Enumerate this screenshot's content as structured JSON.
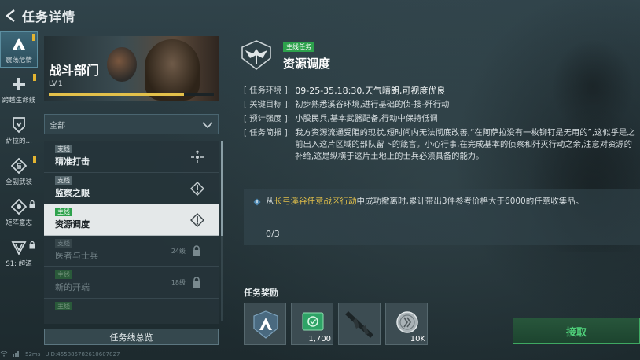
{
  "header": {
    "title": "任务详情"
  },
  "rail": {
    "items": [
      {
        "label": "震荡危情",
        "icon": "a-logo-icon",
        "active": true,
        "badge": true,
        "locked": false
      },
      {
        "label": "跨越生命线",
        "icon": "medical-cross-icon",
        "active": false,
        "badge": true,
        "locked": false
      },
      {
        "label": "萨拉的…",
        "icon": "shield-chevron-icon",
        "active": false,
        "badge": false,
        "locked": false
      },
      {
        "label": "全副武装",
        "icon": "diamond-s-icon",
        "active": false,
        "badge": true,
        "locked": false
      },
      {
        "label": "矩阵意志",
        "icon": "matrix-icon",
        "active": false,
        "badge": false,
        "locked": true
      },
      {
        "label": "S1: 超源",
        "icon": "triangle-v-icon",
        "active": false,
        "badge": false,
        "locked": true
      }
    ]
  },
  "department": {
    "name": "战斗部门",
    "level": "LV.1",
    "xp_fraction": 0.82
  },
  "filter": {
    "selected": "全部"
  },
  "missions": [
    {
      "tag": "支线",
      "tag_type": "side",
      "name": "精准打击",
      "state": "available",
      "level": ""
    },
    {
      "tag": "支线",
      "tag_type": "side",
      "name": "监察之眼",
      "state": "available",
      "level": ""
    },
    {
      "tag": "主线",
      "tag_type": "main",
      "name": "资源调度",
      "state": "active",
      "level": ""
    },
    {
      "tag": "支线",
      "tag_type": "side",
      "name": "医者与士兵",
      "state": "locked",
      "level": "24级"
    },
    {
      "tag": "主线",
      "tag_type": "main",
      "name": "新的开端",
      "state": "locked",
      "level": "18级"
    },
    {
      "tag": "主线",
      "tag_type": "main",
      "name": "",
      "state": "locked",
      "level": ""
    }
  ],
  "overview_button": "任务线总览",
  "footer": {
    "ping": "52ms",
    "uid": "UID:455885782610607827"
  },
  "detail": {
    "tag": "主线任务",
    "title": "资源调度",
    "env_key": "[ 任务环境 ]:",
    "env_val": "09-25-35,18:30,天气晴朗,可视度优良",
    "goal_key": "[ 关键目标 ]:",
    "goal_val": "初步熟悉溪谷环境,进行基础的侦-搜-歼行动",
    "intensity_key": "[ 预计强度 ]:",
    "intensity_val": "小股民兵,基本武器配备,行动中保持低调",
    "brief_key": "[ 任务简报 ]:",
    "brief_val": "我方资源流通受阻的现状,短时间内无法彻底改善,“在阿萨拉没有一枚铆钉是无用的”,这似乎是之前出入这片区域的部队留下的箴言。小心行事,在完成基本的侦察和歼灭行动之余,注意对资源的补给,这是纵横于这片土地上的士兵必须具备的能力。"
  },
  "objective": {
    "prefix": "从",
    "highlight": "长弓溪谷任意战区行动",
    "suffix": "中成功撤离时,累计带出3件参考价格大于6000的任意收集品。",
    "progress": "0/3"
  },
  "rewards": {
    "label": "任务奖励",
    "items": [
      {
        "icon": "a-logo-icon",
        "count": ""
      },
      {
        "icon": "credit-chip-icon",
        "count": "1,700"
      },
      {
        "icon": "rifle-icon",
        "count": ""
      },
      {
        "icon": "coin-icon",
        "count": "10K"
      }
    ]
  },
  "accept_button": "接取",
  "colors": {
    "main_tag": "#2da24c",
    "highlight": "#e3c04a",
    "accept": "#4fd07a",
    "badge": "#e3b431"
  }
}
